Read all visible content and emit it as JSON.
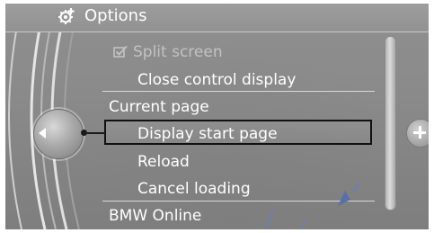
{
  "title_bar": {
    "icon": "gear-options-icon",
    "title": "Options"
  },
  "menu": {
    "split_screen": {
      "label": "Split screen",
      "icon": "checkbox-check-icon",
      "enabled": false
    },
    "close_control_display": "Close control display",
    "section_current_page": "Current page",
    "display_start_page": "Display start page",
    "reload": "Reload",
    "cancel_loading": "Cancel loading",
    "section_bmw_online": "BMW Online"
  },
  "controls": {
    "knob_icon": "left-arrow-icon",
    "plus_icon": "plus-icon"
  },
  "colors": {
    "background": "#8b8b8b",
    "text": "#ffffff",
    "disabled_text": "#c2c2c2",
    "highlight_border": "#111111"
  }
}
